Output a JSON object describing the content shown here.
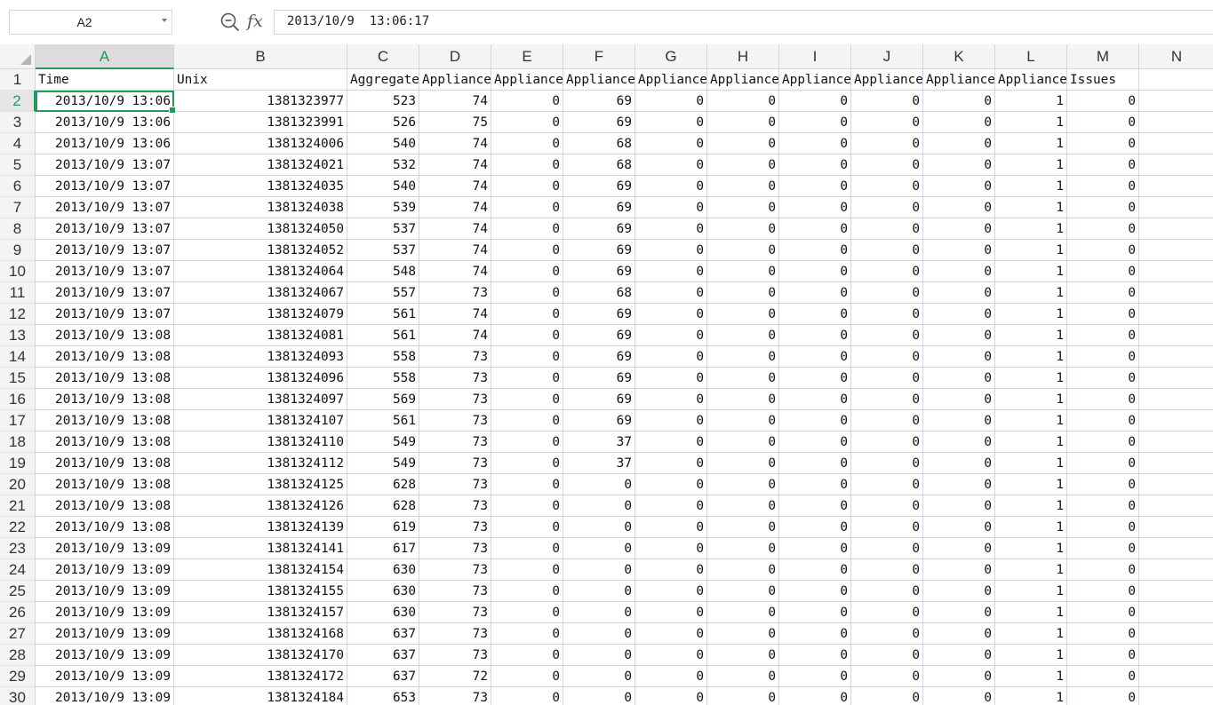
{
  "formula_bar": {
    "name_box": "A2",
    "fx_label": "fx",
    "formula": "2013/10/9  13:06:17"
  },
  "icons": {
    "zoom": "zoom-in-icon",
    "function": "function-icon",
    "name_box_dropdown": "chevron-down-icon"
  },
  "colors": {
    "accent": "#1f9c5d",
    "header_bg": "#f4f4f4",
    "active_header_bg": "#dcdcdc",
    "gridline": "#d4d4e8"
  },
  "selection": {
    "cell": "A2"
  },
  "sheet": {
    "columns": [
      "A",
      "B",
      "C",
      "D",
      "E",
      "F",
      "G",
      "H",
      "I",
      "J",
      "K",
      "L",
      "M",
      "N"
    ],
    "header_row": [
      "Time",
      "Unix",
      "Aggregate",
      "Appliance",
      "Appliance",
      "Appliance",
      "Appliance",
      "Appliance",
      "Appliance",
      "Appliance",
      "Appliance",
      "Appliance",
      "Issues",
      ""
    ],
    "rows": [
      {
        "row": "2",
        "time": "2013/10/9  13:06",
        "unix": "1381323977",
        "vals": [
          "523",
          "74",
          "0",
          "69",
          "0",
          "0",
          "0",
          "0",
          "0",
          "1",
          "0"
        ]
      },
      {
        "row": "3",
        "time": "2013/10/9  13:06",
        "unix": "1381323991",
        "vals": [
          "526",
          "75",
          "0",
          "69",
          "0",
          "0",
          "0",
          "0",
          "0",
          "1",
          "0"
        ]
      },
      {
        "row": "4",
        "time": "2013/10/9  13:06",
        "unix": "1381324006",
        "vals": [
          "540",
          "74",
          "0",
          "68",
          "0",
          "0",
          "0",
          "0",
          "0",
          "1",
          "0"
        ]
      },
      {
        "row": "5",
        "time": "2013/10/9  13:07",
        "unix": "1381324021",
        "vals": [
          "532",
          "74",
          "0",
          "68",
          "0",
          "0",
          "0",
          "0",
          "0",
          "1",
          "0"
        ]
      },
      {
        "row": "6",
        "time": "2013/10/9  13:07",
        "unix": "1381324035",
        "vals": [
          "540",
          "74",
          "0",
          "69",
          "0",
          "0",
          "0",
          "0",
          "0",
          "1",
          "0"
        ]
      },
      {
        "row": "7",
        "time": "2013/10/9  13:07",
        "unix": "1381324038",
        "vals": [
          "539",
          "74",
          "0",
          "69",
          "0",
          "0",
          "0",
          "0",
          "0",
          "1",
          "0"
        ]
      },
      {
        "row": "8",
        "time": "2013/10/9  13:07",
        "unix": "1381324050",
        "vals": [
          "537",
          "74",
          "0",
          "69",
          "0",
          "0",
          "0",
          "0",
          "0",
          "1",
          "0"
        ]
      },
      {
        "row": "9",
        "time": "2013/10/9  13:07",
        "unix": "1381324052",
        "vals": [
          "537",
          "74",
          "0",
          "69",
          "0",
          "0",
          "0",
          "0",
          "0",
          "1",
          "0"
        ]
      },
      {
        "row": "10",
        "time": "2013/10/9  13:07",
        "unix": "1381324064",
        "vals": [
          "548",
          "74",
          "0",
          "69",
          "0",
          "0",
          "0",
          "0",
          "0",
          "1",
          "0"
        ]
      },
      {
        "row": "11",
        "time": "2013/10/9  13:07",
        "unix": "1381324067",
        "vals": [
          "557",
          "73",
          "0",
          "68",
          "0",
          "0",
          "0",
          "0",
          "0",
          "1",
          "0"
        ]
      },
      {
        "row": "12",
        "time": "2013/10/9  13:07",
        "unix": "1381324079",
        "vals": [
          "561",
          "74",
          "0",
          "69",
          "0",
          "0",
          "0",
          "0",
          "0",
          "1",
          "0"
        ]
      },
      {
        "row": "13",
        "time": "2013/10/9  13:08",
        "unix": "1381324081",
        "vals": [
          "561",
          "74",
          "0",
          "69",
          "0",
          "0",
          "0",
          "0",
          "0",
          "1",
          "0"
        ]
      },
      {
        "row": "14",
        "time": "2013/10/9  13:08",
        "unix": "1381324093",
        "vals": [
          "558",
          "73",
          "0",
          "69",
          "0",
          "0",
          "0",
          "0",
          "0",
          "1",
          "0"
        ]
      },
      {
        "row": "15",
        "time": "2013/10/9  13:08",
        "unix": "1381324096",
        "vals": [
          "558",
          "73",
          "0",
          "69",
          "0",
          "0",
          "0",
          "0",
          "0",
          "1",
          "0"
        ]
      },
      {
        "row": "16",
        "time": "2013/10/9  13:08",
        "unix": "1381324097",
        "vals": [
          "569",
          "73",
          "0",
          "69",
          "0",
          "0",
          "0",
          "0",
          "0",
          "1",
          "0"
        ]
      },
      {
        "row": "17",
        "time": "2013/10/9  13:08",
        "unix": "1381324107",
        "vals": [
          "561",
          "73",
          "0",
          "69",
          "0",
          "0",
          "0",
          "0",
          "0",
          "1",
          "0"
        ]
      },
      {
        "row": "18",
        "time": "2013/10/9  13:08",
        "unix": "1381324110",
        "vals": [
          "549",
          "73",
          "0",
          "37",
          "0",
          "0",
          "0",
          "0",
          "0",
          "1",
          "0"
        ]
      },
      {
        "row": "19",
        "time": "2013/10/9  13:08",
        "unix": "1381324112",
        "vals": [
          "549",
          "73",
          "0",
          "37",
          "0",
          "0",
          "0",
          "0",
          "0",
          "1",
          "0"
        ]
      },
      {
        "row": "20",
        "time": "2013/10/9  13:08",
        "unix": "1381324125",
        "vals": [
          "628",
          "73",
          "0",
          "0",
          "0",
          "0",
          "0",
          "0",
          "0",
          "1",
          "0"
        ]
      },
      {
        "row": "21",
        "time": "2013/10/9  13:08",
        "unix": "1381324126",
        "vals": [
          "628",
          "73",
          "0",
          "0",
          "0",
          "0",
          "0",
          "0",
          "0",
          "1",
          "0"
        ]
      },
      {
        "row": "22",
        "time": "2013/10/9  13:08",
        "unix": "1381324139",
        "vals": [
          "619",
          "73",
          "0",
          "0",
          "0",
          "0",
          "0",
          "0",
          "0",
          "1",
          "0"
        ]
      },
      {
        "row": "23",
        "time": "2013/10/9  13:09",
        "unix": "1381324141",
        "vals": [
          "617",
          "73",
          "0",
          "0",
          "0",
          "0",
          "0",
          "0",
          "0",
          "1",
          "0"
        ]
      },
      {
        "row": "24",
        "time": "2013/10/9  13:09",
        "unix": "1381324154",
        "vals": [
          "630",
          "73",
          "0",
          "0",
          "0",
          "0",
          "0",
          "0",
          "0",
          "1",
          "0"
        ]
      },
      {
        "row": "25",
        "time": "2013/10/9  13:09",
        "unix": "1381324155",
        "vals": [
          "630",
          "73",
          "0",
          "0",
          "0",
          "0",
          "0",
          "0",
          "0",
          "1",
          "0"
        ]
      },
      {
        "row": "26",
        "time": "2013/10/9  13:09",
        "unix": "1381324157",
        "vals": [
          "630",
          "73",
          "0",
          "0",
          "0",
          "0",
          "0",
          "0",
          "0",
          "1",
          "0"
        ]
      },
      {
        "row": "27",
        "time": "2013/10/9  13:09",
        "unix": "1381324168",
        "vals": [
          "637",
          "73",
          "0",
          "0",
          "0",
          "0",
          "0",
          "0",
          "0",
          "1",
          "0"
        ]
      },
      {
        "row": "28",
        "time": "2013/10/9  13:09",
        "unix": "1381324170",
        "vals": [
          "637",
          "73",
          "0",
          "0",
          "0",
          "0",
          "0",
          "0",
          "0",
          "1",
          "0"
        ]
      },
      {
        "row": "29",
        "time": "2013/10/9  13:09",
        "unix": "1381324172",
        "vals": [
          "637",
          "72",
          "0",
          "0",
          "0",
          "0",
          "0",
          "0",
          "0",
          "1",
          "0"
        ]
      },
      {
        "row": "30",
        "time": "2013/10/9  13:09",
        "unix": "1381324184",
        "vals": [
          "653",
          "73",
          "0",
          "0",
          "0",
          "0",
          "0",
          "0",
          "0",
          "1",
          "0"
        ]
      }
    ]
  }
}
